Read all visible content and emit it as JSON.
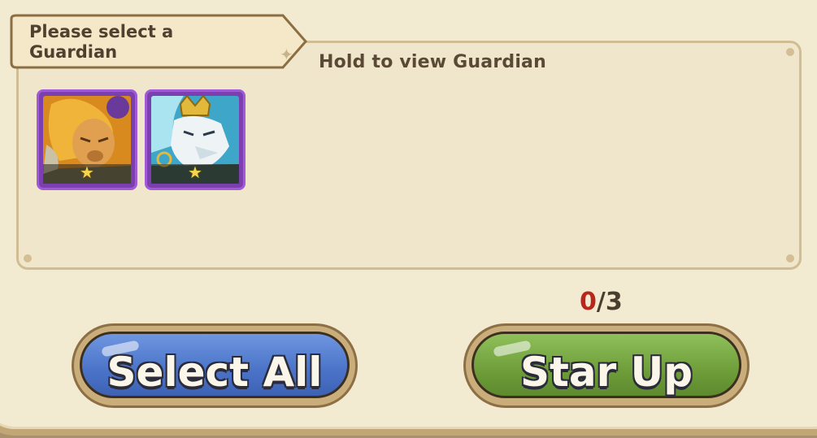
{
  "tag": {
    "title": "Please select a Guardian"
  },
  "hint": "Hold to view Guardian",
  "guardians": [
    {
      "name": "lion-guardian",
      "stars": "★"
    },
    {
      "name": "wolf-king-guardian",
      "stars": "★"
    }
  ],
  "counter": {
    "current": "0",
    "separator": "/",
    "max": "3"
  },
  "buttons": {
    "select_all": "Select All",
    "star_up": "Star Up"
  },
  "colors": {
    "blue_button": "#4a73c8",
    "green_button": "#6e9d3a",
    "card_frame": "#7c3fb0",
    "counter_current": "#b8261c"
  }
}
